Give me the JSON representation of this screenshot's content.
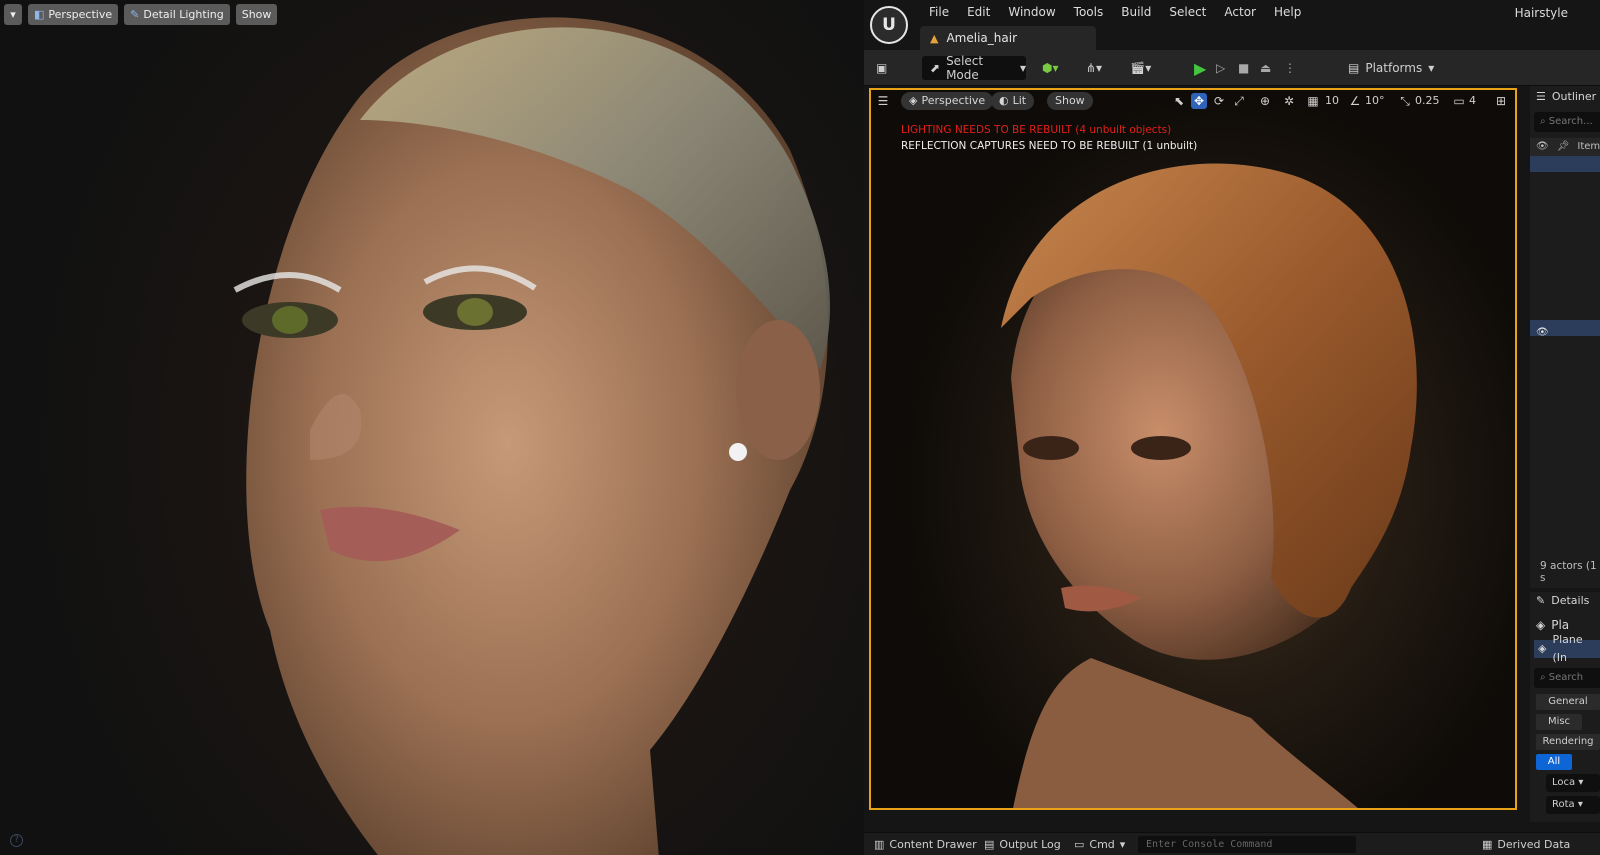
{
  "left_viewport": {
    "menu_icon": "chevron-down-icon",
    "perspective_label": "Perspective",
    "lighting_label": "Detail Lighting",
    "show_label": "Show"
  },
  "menubar": {
    "items": [
      "File",
      "Edit",
      "Window",
      "Tools",
      "Build",
      "Select",
      "Actor",
      "Help"
    ],
    "project_name": "Hairstyle"
  },
  "doc_tab": {
    "label": "Amelia_hair"
  },
  "toolbar": {
    "select_mode": "Select Mode",
    "platforms": "Platforms"
  },
  "viewport": {
    "perspective": "Perspective",
    "lit": "Lit",
    "show": "Show",
    "grid_snap": "10",
    "rotation_snap": "10°",
    "scale_snap": "0.25",
    "camera_speed": "4",
    "msg_lighting": "LIGHTING NEEDS TO BE REBUILT (4 unbuilt objects)",
    "msg_reflection": "REFLECTION CAPTURES NEED TO BE REBUILT (1 unbuilt)"
  },
  "outliner": {
    "title": "Outliner",
    "search_placeholder": "Search...",
    "column_item": "Item",
    "actor_count": "9 actors (1 s"
  },
  "details": {
    "title": "Details",
    "object_name": "Pla",
    "component": "Plane (In",
    "search_placeholder": "Search",
    "filters": [
      "General",
      "Misc",
      "Rendering"
    ],
    "filter_all": "All",
    "location": "Loca",
    "rotation": "Rota"
  },
  "statusbar": {
    "content_drawer": "Content Drawer",
    "output_log": "Output Log",
    "cmd": "Cmd",
    "console_placeholder": "Enter Console Command",
    "derived_data": "Derived Data"
  },
  "colors": {
    "accent_blue": "#0e66d6",
    "viewport_border": "#e8a317",
    "warning_red": "#e0201a",
    "play_green": "#43c53f"
  }
}
